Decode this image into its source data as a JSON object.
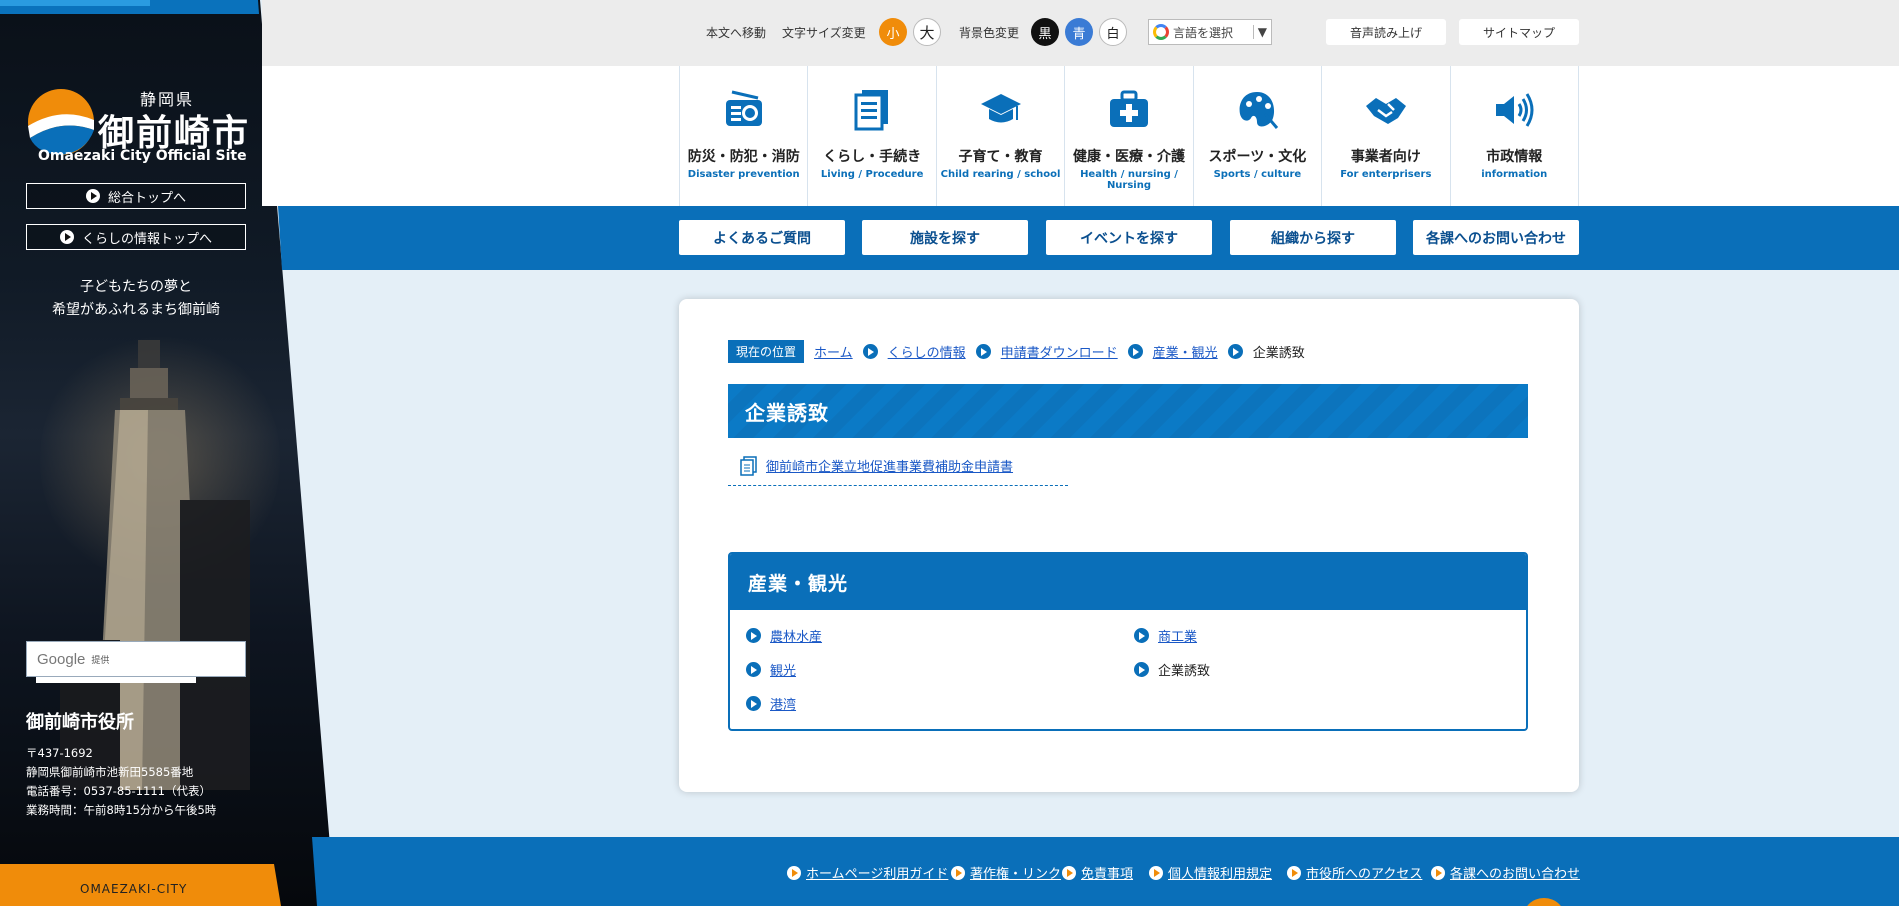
{
  "sidebar": {
    "logo_pref": "静岡県",
    "logo_city": "御前崎市",
    "logo_en": "Omaezaki City Official Site",
    "btn_top": "総合トップへ",
    "btn_life": "くらしの情報トップへ",
    "slogan_1": "子どもたちの夢と",
    "slogan_2": "希望があふれるまち御前崎",
    "google_label": "Google",
    "google_provided": "提供",
    "office_name": "御前崎市役所",
    "postal": "〒437-1692",
    "address": "静岡県御前崎市池新田5585番地",
    "phone": "電話番号：0537-85-1111（代表）",
    "hours": "業務時間：午前8時15分から午後5時",
    "footer_text": "OMAEZAKI-CITY"
  },
  "utility": {
    "skip": "本文へ移動",
    "font_size": "文字サイズ変更",
    "font_small": "小",
    "font_large": "大",
    "bg_color": "背景色変更",
    "bg_black": "黒",
    "bg_blue": "青",
    "bg_white": "白",
    "language": "言語を選択",
    "language_arrow": "▼",
    "read_aloud": "音声読み上げ",
    "sitemap": "サイトマップ",
    "colors": {
      "orange": "#f08c0a",
      "blue": "#3a7bd5",
      "black": "#111111"
    }
  },
  "categories": [
    {
      "jp": "防災・防犯・消防",
      "en": "Disaster prevention",
      "icon": "radio-icon"
    },
    {
      "jp": "くらし・手続き",
      "en": "Living / Procedure",
      "icon": "document-icon"
    },
    {
      "jp": "子育て・教育",
      "en": "Child rearing / school",
      "icon": "graduation-cap-icon"
    },
    {
      "jp": "健康・医療・介護",
      "en": "Health / nursing / Nursing",
      "icon": "medical-bag-icon"
    },
    {
      "jp": "スポーツ・文化",
      "en": "Sports / culture",
      "icon": "palette-icon"
    },
    {
      "jp": "事業者向け",
      "en": "For enterprisers",
      "icon": "handshake-icon"
    },
    {
      "jp": "市政情報",
      "en": "information",
      "icon": "speaker-icon"
    }
  ],
  "subnav": [
    "よくあるご質問",
    "施設を探す",
    "イベントを探す",
    "組織から探す",
    "各課へのお問い合わせ"
  ],
  "breadcrumb": {
    "label": "現在の位置",
    "items": [
      "ホーム",
      "くらしの情報",
      "申請書ダウンロード",
      "産業・観光"
    ],
    "current": "企業誘致"
  },
  "page": {
    "title": "企業誘致",
    "doc_link": "御前崎市企業立地促進事業費補助金申請書"
  },
  "section": {
    "title": "産業・観光",
    "items": [
      "農林水産",
      "商工業",
      "観光",
      "企業誘致",
      "港湾"
    ]
  },
  "footer": {
    "links": [
      "ホームページ利用ガイド",
      "著作権・リンク",
      "免責事項",
      "個人情報利用規定",
      "市役所へのアクセス",
      "各課へのお問い合わせ"
    ]
  },
  "colors": {
    "primary_blue": "#0a6fb9",
    "accent_orange": "#f08c0a",
    "link": "#1a58c6"
  }
}
